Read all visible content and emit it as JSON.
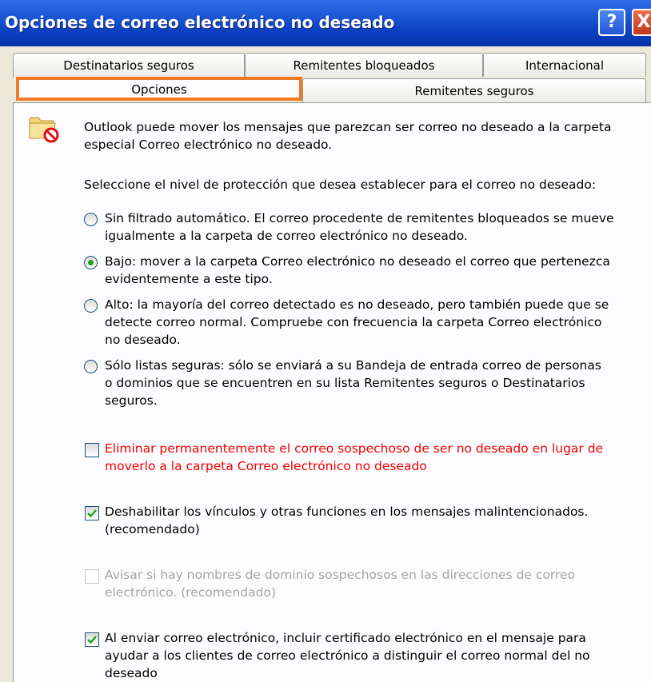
{
  "window": {
    "title": "Opciones de correo electrónico no deseado",
    "help_label": "?",
    "close_label": "X"
  },
  "tabs": {
    "row1": [
      "Destinatarios seguros",
      "Remitentes bloqueados",
      "Internacional"
    ],
    "row2": [
      "Opciones",
      "Remitentes seguros"
    ],
    "selected": "Opciones"
  },
  "intro": {
    "line1": "Outlook puede mover los mensajes que parezcan ser correo no deseado a la carpeta",
    "line2": "especial Correo electrónico no deseado."
  },
  "protection_prompt": "Seleccione el nivel de protección que desea establecer para el correo no deseado:",
  "radio_options": [
    {
      "lines": [
        "Sin filtrado automático. El correo procedente de remitentes bloqueados se mueve",
        "igualmente a la carpeta de correo electrónico no deseado."
      ],
      "selected": false
    },
    {
      "lines": [
        "Bajo: mover a la carpeta Correo electrónico no deseado el correo que pertenezca",
        "evidentemente a este tipo."
      ],
      "selected": true
    },
    {
      "lines": [
        "Alto: la mayoría del correo detectado es no deseado, pero también puede que se",
        "detecte correo normal. Compruebe con frecuencia la carpeta Correo electrónico",
        "no deseado."
      ],
      "selected": false
    },
    {
      "lines": [
        "Sólo listas seguras: sólo se enviará a su Bandeja de entrada correo de personas",
        "o dominios que se encuentren en su lista Remitentes seguros o Destinatarios",
        "seguros."
      ],
      "selected": false
    }
  ],
  "checkboxes": [
    {
      "lines": [
        "Eliminar permanentemente el correo sospechoso de ser no deseado en lugar de",
        "moverlo a la carpeta Correo electrónico no deseado"
      ],
      "checked": false,
      "enabled": true,
      "color": "#F00000"
    },
    {
      "lines": [
        "Deshabilitar los vínculos y otras funciones en los mensajes malintencionados.",
        "(recomendado)"
      ],
      "checked": true,
      "enabled": true
    },
    {
      "lines": [
        "Avisar si hay nombres de dominio sospechosos en las direcciones de correo",
        "electrónico. (recomendado)"
      ],
      "checked": false,
      "enabled": false
    },
    {
      "lines": [
        "Al enviar correo electrónico, incluir certificado electrónico en el mensaje para",
        "ayudar a los clientes de correo electrónico a distinguir el correo normal del no",
        "deseado"
      ],
      "checked": true,
      "enabled": true
    }
  ],
  "colors": {
    "titlebar": "#0A3FC0",
    "selected_tab_highlight": "#F07B24",
    "check_mark": "#21A121",
    "radio_dot": "#21A121",
    "disabled_text": "#A7A69C"
  }
}
